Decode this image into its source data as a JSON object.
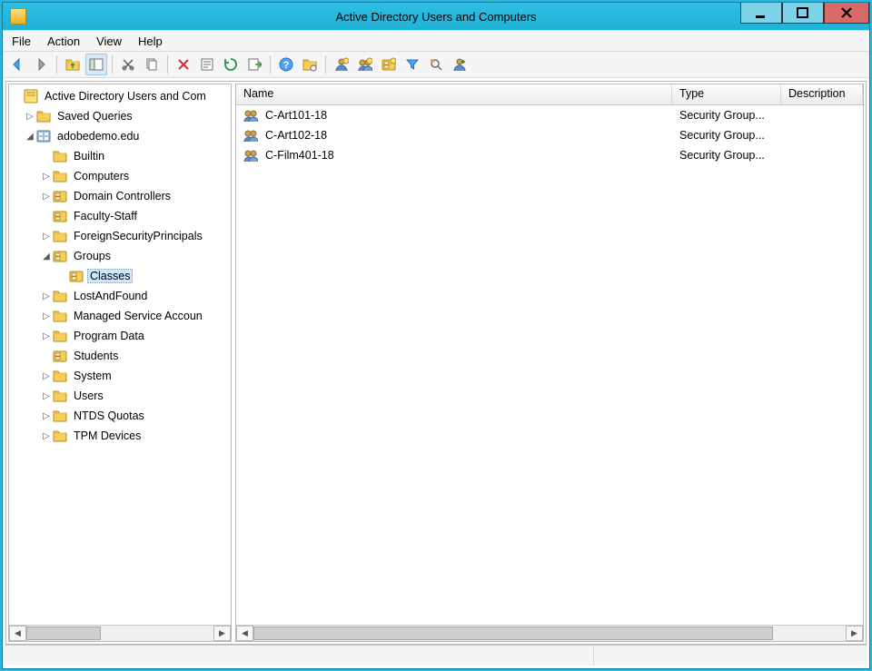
{
  "window": {
    "title": "Active Directory Users and Computers"
  },
  "menu": {
    "file": "File",
    "action": "Action",
    "view": "View",
    "help": "Help"
  },
  "columns": {
    "name": "Name",
    "type": "Type",
    "description": "Description"
  },
  "tree": {
    "root": {
      "label": "Active Directory Users and Com"
    },
    "saved": {
      "label": "Saved Queries"
    },
    "domain": {
      "label": "adobedemo.edu"
    },
    "builtin": {
      "label": "Builtin"
    },
    "computers": {
      "label": "Computers"
    },
    "dc": {
      "label": "Domain Controllers"
    },
    "faculty": {
      "label": "Faculty-Staff"
    },
    "fsp": {
      "label": "ForeignSecurityPrincipals"
    },
    "groups": {
      "label": "Groups"
    },
    "classes": {
      "label": "Classes"
    },
    "laf": {
      "label": "LostAndFound"
    },
    "msa": {
      "label": "Managed Service Accoun"
    },
    "pdata": {
      "label": "Program Data"
    },
    "students": {
      "label": "Students"
    },
    "system": {
      "label": "System"
    },
    "users": {
      "label": "Users"
    },
    "ntds": {
      "label": "NTDS Quotas"
    },
    "tpm": {
      "label": "TPM Devices"
    }
  },
  "list": {
    "items": [
      {
        "name": "C-Art101-18",
        "type": "Security Group..."
      },
      {
        "name": "C-Art102-18",
        "type": "Security Group..."
      },
      {
        "name": "C-Film401-18",
        "type": "Security Group..."
      }
    ]
  }
}
